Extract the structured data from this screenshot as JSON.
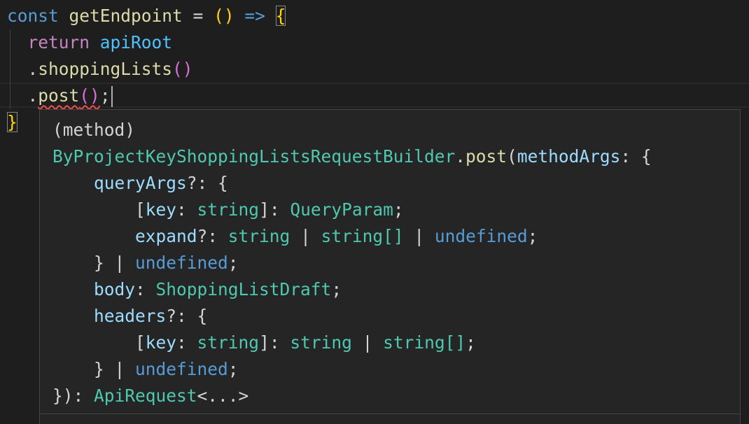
{
  "editor": {
    "line1": {
      "kw_const": "const",
      "fn_name": "getEndpoint",
      "eq": " = ",
      "params": "()",
      "arrow": " => ",
      "open_brace": "{"
    },
    "line2": {
      "kw_return": "return",
      "var_root": "apiRoot"
    },
    "line3": {
      "dot": ".",
      "method": "shoppingLists",
      "parens": "()"
    },
    "line4": {
      "dot": ".",
      "method": "post",
      "parens": "()",
      "semicolon": ";"
    },
    "line5": {
      "close_brace": "}"
    }
  },
  "hover": {
    "kind": "(method)",
    "class_name": "ByProjectKeyShoppingListsRequestBuilder",
    "method_name": "post",
    "param_name": "methodArgs",
    "query_args": "queryArgs",
    "key": "key",
    "string": "string",
    "query_param": "QueryParam",
    "expand": "expand",
    "string_array": "string[]",
    "undefined": "undefined",
    "body": "body",
    "draft": "ShoppingListDraft",
    "headers": "headers",
    "return_type": "ApiRequest",
    "return_generic": "<...>"
  },
  "colors": {
    "background": "#1e1e1e",
    "hover_background": "#252526",
    "keyword": "#569cd6",
    "control_keyword": "#c586c0",
    "function": "#dcdcaa",
    "variable": "#9cdcfe",
    "type": "#4ec9b0",
    "bracket_gold": "#ffd700",
    "bracket_orchid": "#da70d6",
    "error_squiggle": "#f14c4c"
  }
}
